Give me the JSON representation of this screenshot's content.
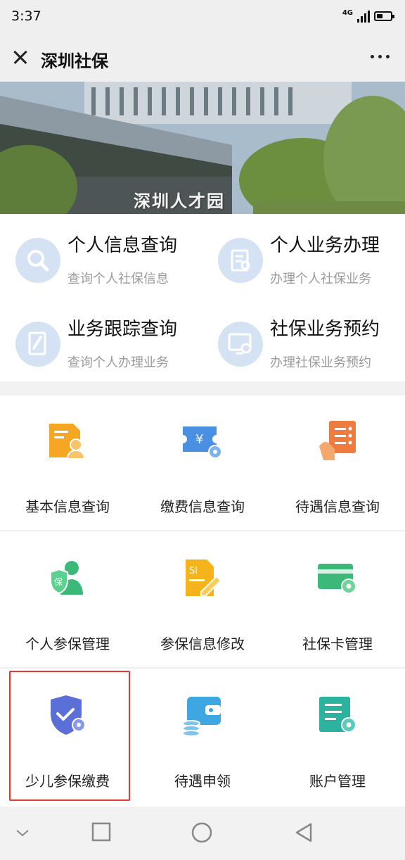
{
  "status_bar": {
    "time": "3:37",
    "network": "4G"
  },
  "nav": {
    "title": "深圳社保"
  },
  "banner": {
    "sign_text": "深圳人才园"
  },
  "quick_services": [
    {
      "title": "个人信息查询",
      "subtitle": "查询个人社保信息",
      "icon": "search-icon"
    },
    {
      "title": "个人业务办理",
      "subtitle": "办理个人社保业务",
      "icon": "document-edit-icon"
    },
    {
      "title": "业务跟踪查询",
      "subtitle": "查询个人办理业务",
      "icon": "pen-icon"
    },
    {
      "title": "社保业务预约",
      "subtitle": "办理社保业务预约",
      "icon": "monitor-clock-icon"
    }
  ],
  "grid": [
    {
      "label": "基本信息查询",
      "icon": "user-document-icon",
      "color": "#f5a623"
    },
    {
      "label": "缴费信息查询",
      "icon": "yuan-ticket-icon",
      "color": "#4a90e2"
    },
    {
      "label": "待遇信息查询",
      "icon": "hand-list-icon",
      "color": "#f07b3f"
    },
    {
      "label": "个人参保管理",
      "icon": "shield-person-icon",
      "color": "#3cb878"
    },
    {
      "label": "参保信息修改",
      "icon": "si-document-edit-icon",
      "color": "#f5b31c"
    },
    {
      "label": "社保卡管理",
      "icon": "card-gear-icon",
      "color": "#3cb878"
    },
    {
      "label": "少儿参保缴费",
      "icon": "shield-check-icon",
      "color": "#5b6fd8"
    },
    {
      "label": "待遇申领",
      "icon": "wallet-coins-icon",
      "color": "#3ea6e0"
    },
    {
      "label": "账户管理",
      "icon": "list-gear-icon",
      "color": "#2bb3a0"
    }
  ],
  "colors": {
    "highlight": "#e53935",
    "quick_circle": "#d5e2f3",
    "subtitle": "#9a9a9a"
  }
}
